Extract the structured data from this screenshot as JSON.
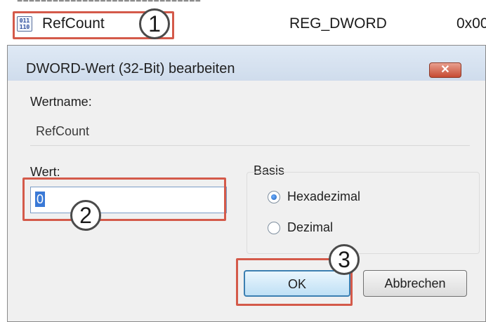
{
  "registry": {
    "row": {
      "icon": "reg-dword-icon",
      "icon_text": "011\n110",
      "name": "RefCount",
      "type": "REG_DWORD",
      "data": "0x00"
    }
  },
  "dialog": {
    "title": "DWORD-Wert (32-Bit) bearbeiten",
    "close_label": "✕",
    "value_name_label": "Wertname:",
    "value_name": "RefCount",
    "value_label": "Wert:",
    "value": "0",
    "base_label": "Basis",
    "radios": [
      {
        "label": "Hexadezimal",
        "checked": true
      },
      {
        "label": "Dezimal",
        "checked": false
      }
    ],
    "ok_label": "OK",
    "cancel_label": "Abbrechen"
  },
  "callouts": [
    "1",
    "2",
    "3"
  ],
  "colors": {
    "highlight": "#d45a4a",
    "title_gradient_top": "#dfe9f5",
    "title_gradient_bottom": "#cfdcec",
    "close_red": "#c64a32",
    "ok_blue": "#3c7fb1"
  }
}
